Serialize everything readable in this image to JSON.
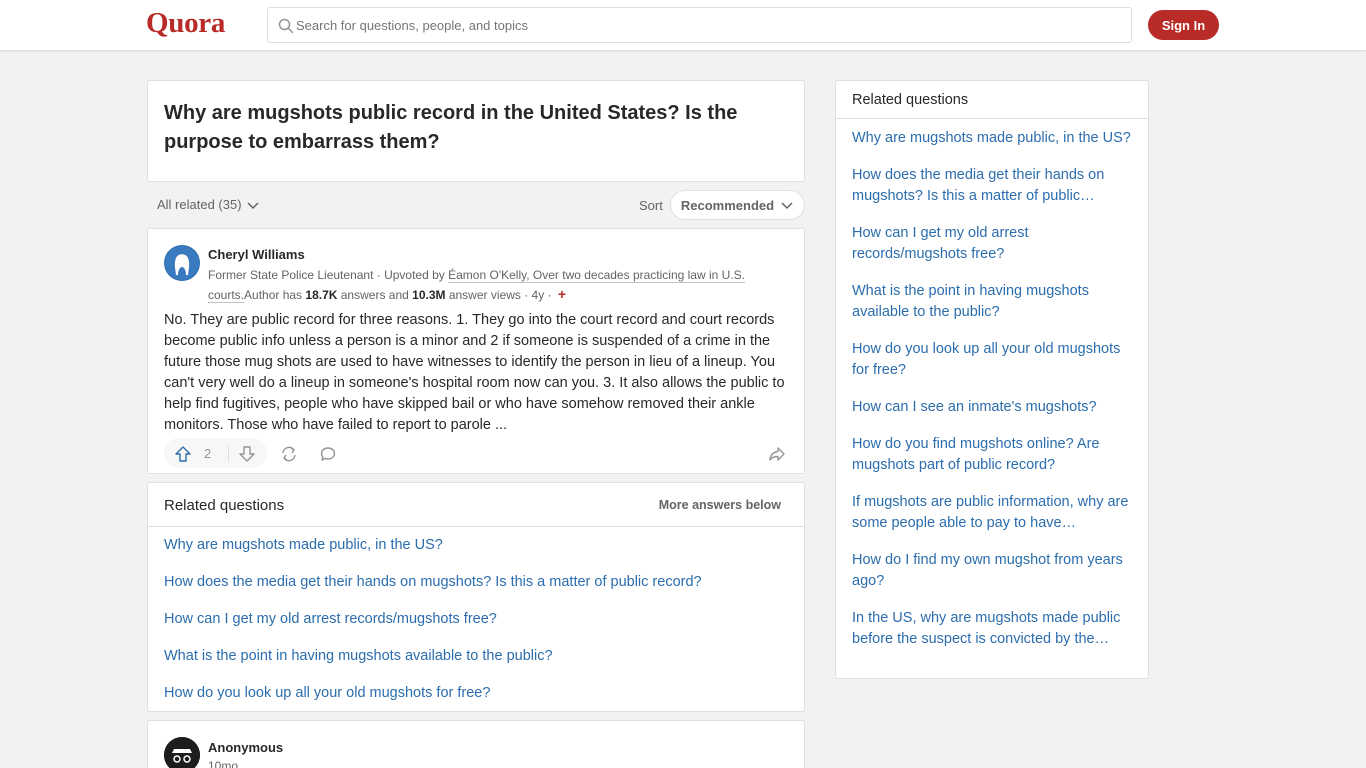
{
  "header": {
    "logo": "Quora",
    "search_placeholder": "Search for questions, people, and topics",
    "signin_label": "Sign In"
  },
  "question": {
    "title": "Why are mugshots public record in the United States? Is the purpose to embarrass them?"
  },
  "filter": {
    "all_related": "All related (35)",
    "sort_label": "Sort",
    "sort_value": "Recommended"
  },
  "answer": {
    "author": "Cheryl Williams",
    "cred_prefix": "Former State Police Lieutenant · Upvoted by ",
    "upvoter": "Éamon O'Kelly, Over two decades practicing law in U.S. courts.",
    "cred_mid1": "Author has ",
    "answers_count": "18.7K",
    "cred_mid2": " answers and ",
    "views_count": "10.3M",
    "cred_mid3": " answer views · 4y · ",
    "body": "No. They are public record for three reasons. 1. They go into the court record and court records become public info unless a person is a minor and 2 if someone is suspended of a crime in the future those mug shots are used to have witnesses to identify the person in lieu of a lineup. You can't very well do a lineup in someone's hospital room now can you. 3. It also allows the public to help find fugitives, people who have skipped bail or who have somehow removed their ankle monitors. Those who have failed to report to parole ...",
    "upvotes": "2"
  },
  "related_feed": {
    "title": "Related questions",
    "more": "More answers below",
    "items": [
      "Why are mugshots made public, in the US?",
      "How does the media get their hands on mugshots? Is this a matter of public record?",
      "How can I get my old arrest records/mugshots free?",
      "What is the point in having mugshots available to the public?",
      "How do you look up all your old mugshots for free?"
    ]
  },
  "anon_answer": {
    "author": "Anonymous",
    "time": "10mo"
  },
  "sidebar": {
    "title": "Related questions",
    "items": [
      "Why are mugshots made public, in the US?",
      "How does the media get their hands on mugshots? Is this a matter of public…",
      "How can I get my old arrest records/mugshots free?",
      "What is the point in having mugshots available to the public?",
      "How do you look up all your old mugshots for free?",
      "How can I see an inmate's mugshots?",
      "How do you find mugshots online? Are mugshots part of public record?",
      "If mugshots are public information, why are some people able to pay to have…",
      "How do I find my own mugshot from years ago?",
      "In the US, why are mugshots made public before the suspect is convicted by the…"
    ]
  },
  "colors": {
    "brand": "#b92b27",
    "link": "#2b6dad",
    "background": "#f1f2f2"
  }
}
